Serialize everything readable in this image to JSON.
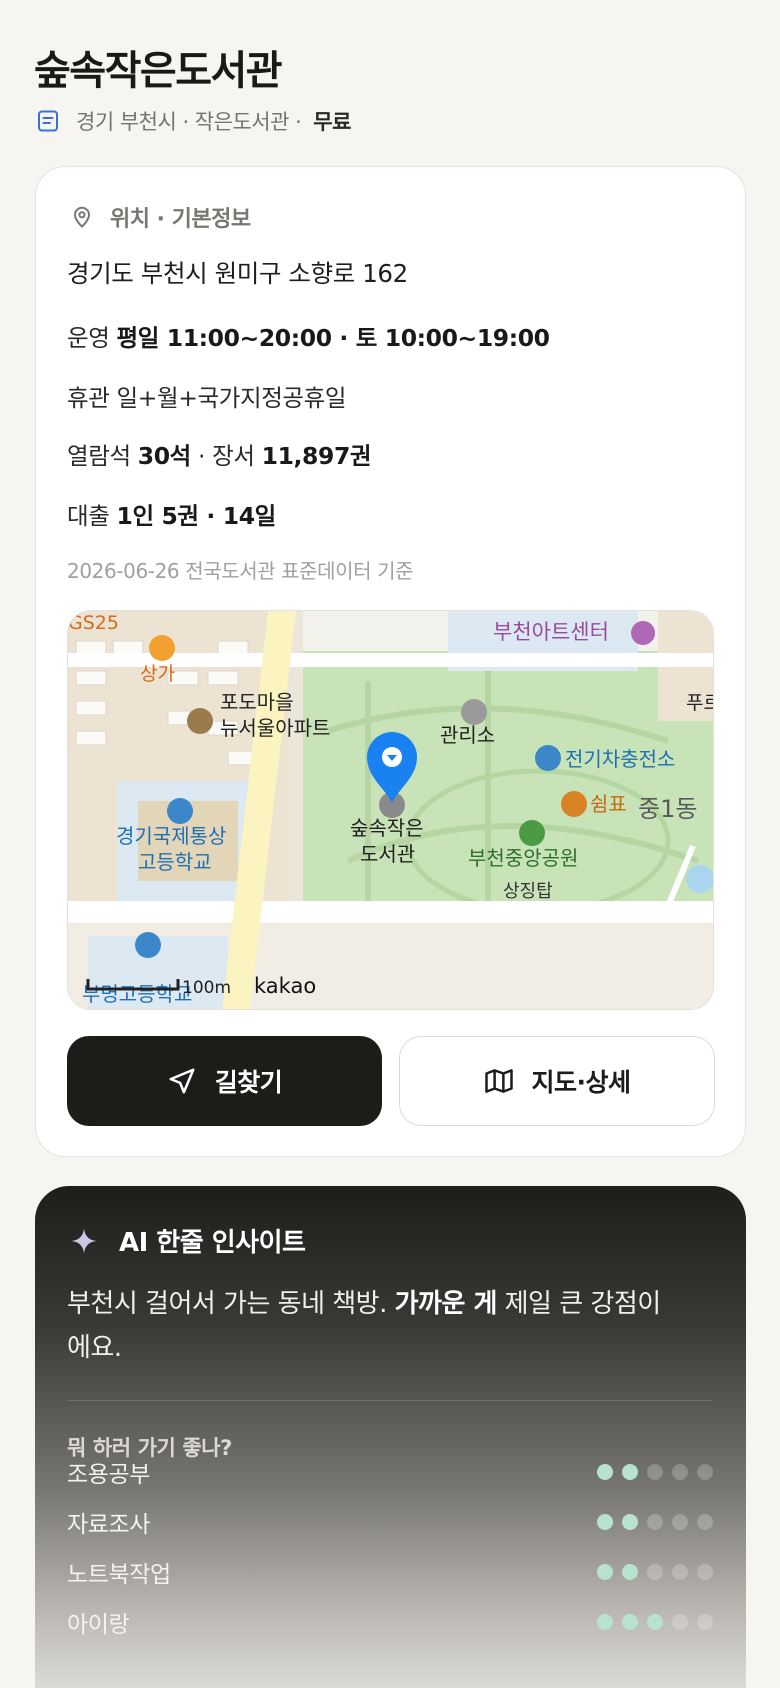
{
  "header": {
    "title": "숲속작은도서관",
    "subtitle": "경기 부천시 · 작은도서관 ·",
    "fee": "무료"
  },
  "info": {
    "section_title": "위치 · 기본정보",
    "address": "경기도 부천시 원미구 소향로 162",
    "hours_label": "운영",
    "hours_value": "평일 11:00~20:00 · 토 10:00~19:00",
    "closed_label": "휴관",
    "closed_value": "일+월+국가지정공휴일",
    "seats_label": "열람석",
    "seats_value": "30석",
    "books_sep": "· 장서",
    "books_value": "11,897권",
    "loan_label": "대출",
    "loan_value": "1인 5권 · 14일",
    "source": "2026-06-26 전국도서관 표준데이터 기준"
  },
  "map": {
    "labels": {
      "gs25": "GS25",
      "shop": "상가",
      "art_center": "부천아트센터",
      "apt_1": "포도마을",
      "apt_2": "뉴서울아파트",
      "office": "관리소",
      "ev": "전기차충전소",
      "cafe": "쉼표",
      "dong": "중1동",
      "lib_1": "숲속작은",
      "lib_2": "도서관",
      "park": "부천중앙공원",
      "tower": "상징탑",
      "school_1a": "경기국제통상",
      "school_1b": "고등학교",
      "school_2": "부명고등학교",
      "edge": "푸르",
      "scale": "100m",
      "brand": "kakao"
    },
    "colors": {
      "park": "#c9e3b8",
      "road": "#ffffff",
      "main_road": "#fbf3c0",
      "block": "#efe8dc",
      "pin": "#1a82f0"
    }
  },
  "buttons": {
    "directions": "길찾기",
    "map_detail": "지도·상세"
  },
  "ai": {
    "title": "AI 한줄 인사이트",
    "text_pre": "부천시 걸어서 가는 동네 책방. ",
    "text_bold": "가까운 게",
    "text_post": " 제일 큰 강점이에요.",
    "question": "뭐 하러 가기 좋나?",
    "ratings": [
      {
        "label": "조용공부",
        "score": 2,
        "max": 5
      },
      {
        "label": "자료조사",
        "score": 2,
        "max": 5
      },
      {
        "label": "노트북작업",
        "score": 2,
        "max": 5
      },
      {
        "label": "아이랑",
        "score": 3,
        "max": 5
      }
    ]
  }
}
